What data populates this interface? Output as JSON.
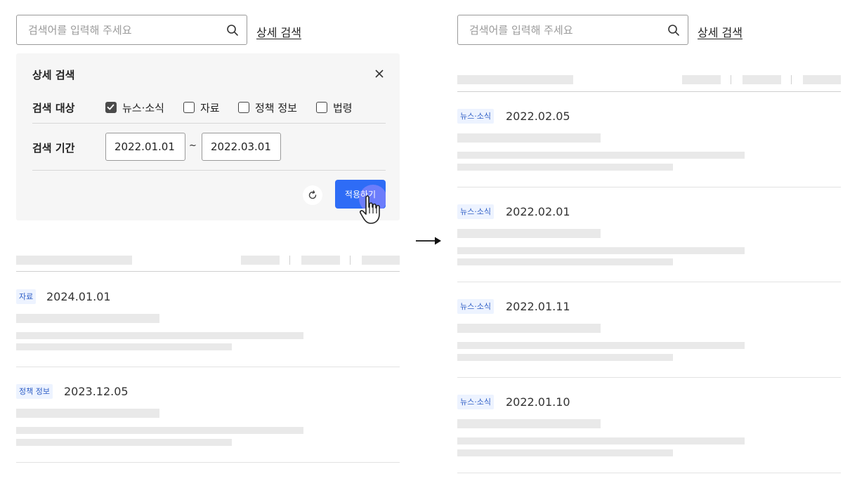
{
  "search": {
    "placeholder": "검색어를 입력해 주세요",
    "value": "",
    "advanced_link": "상세 검색"
  },
  "advanced_panel": {
    "title": "상세 검색",
    "target_label": "검색 대상",
    "targets": [
      {
        "label": "뉴스·소식",
        "checked": true
      },
      {
        "label": "자료",
        "checked": false
      },
      {
        "label": "정책 정보",
        "checked": false
      },
      {
        "label": "법령",
        "checked": false
      }
    ],
    "period_label": "검색 기간",
    "start_date": "2022.01.01",
    "range_separator": "~",
    "end_date": "2022.03.01",
    "apply_label": "적용하기"
  },
  "before_results": [
    {
      "category": "자료",
      "date": "2024.01.01"
    },
    {
      "category": "정책 정보",
      "date": "2023.12.05"
    }
  ],
  "after_results": [
    {
      "category": "뉴스·소식",
      "date": "2022.02.05"
    },
    {
      "category": "뉴스·소식",
      "date": "2022.02.01"
    },
    {
      "category": "뉴스·소식",
      "date": "2022.01.11"
    },
    {
      "category": "뉴스·소식",
      "date": "2022.01.10"
    }
  ],
  "colors": {
    "accent": "#2e6cf6",
    "badge_bg": "#edf3ff",
    "badge_text": "#2f5fc6",
    "panel_bg": "#f6f6f6",
    "skeleton": "#e9e9e9"
  },
  "icons": [
    "search-icon",
    "close-icon",
    "checkmark-icon",
    "refresh-icon",
    "hand-pointer-icon",
    "right-arrow-icon"
  ]
}
